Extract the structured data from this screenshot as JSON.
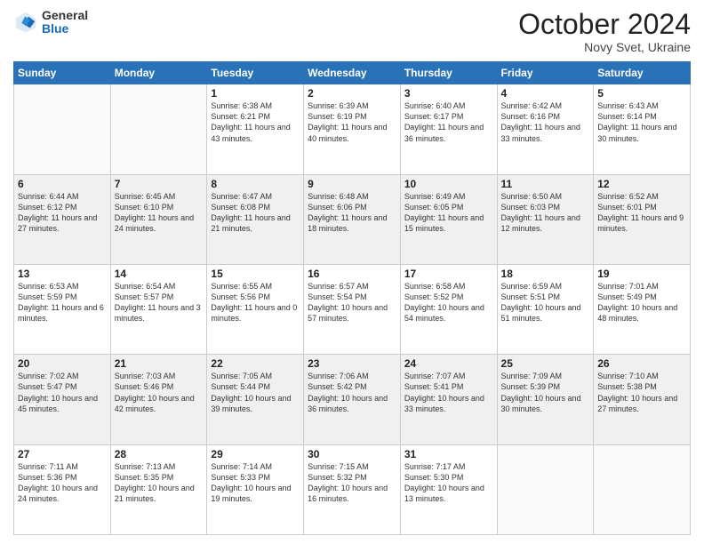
{
  "header": {
    "logo": {
      "general": "General",
      "blue": "Blue"
    },
    "month": "October 2024",
    "location": "Novy Svet, Ukraine"
  },
  "weekdays": [
    "Sunday",
    "Monday",
    "Tuesday",
    "Wednesday",
    "Thursday",
    "Friday",
    "Saturday"
  ],
  "weeks": [
    [
      {
        "day": "",
        "info": ""
      },
      {
        "day": "",
        "info": ""
      },
      {
        "day": "1",
        "info": "Sunrise: 6:38 AM\nSunset: 6:21 PM\nDaylight: 11 hours and 43 minutes."
      },
      {
        "day": "2",
        "info": "Sunrise: 6:39 AM\nSunset: 6:19 PM\nDaylight: 11 hours and 40 minutes."
      },
      {
        "day": "3",
        "info": "Sunrise: 6:40 AM\nSunset: 6:17 PM\nDaylight: 11 hours and 36 minutes."
      },
      {
        "day": "4",
        "info": "Sunrise: 6:42 AM\nSunset: 6:16 PM\nDaylight: 11 hours and 33 minutes."
      },
      {
        "day": "5",
        "info": "Sunrise: 6:43 AM\nSunset: 6:14 PM\nDaylight: 11 hours and 30 minutes."
      }
    ],
    [
      {
        "day": "6",
        "info": "Sunrise: 6:44 AM\nSunset: 6:12 PM\nDaylight: 11 hours and 27 minutes."
      },
      {
        "day": "7",
        "info": "Sunrise: 6:45 AM\nSunset: 6:10 PM\nDaylight: 11 hours and 24 minutes."
      },
      {
        "day": "8",
        "info": "Sunrise: 6:47 AM\nSunset: 6:08 PM\nDaylight: 11 hours and 21 minutes."
      },
      {
        "day": "9",
        "info": "Sunrise: 6:48 AM\nSunset: 6:06 PM\nDaylight: 11 hours and 18 minutes."
      },
      {
        "day": "10",
        "info": "Sunrise: 6:49 AM\nSunset: 6:05 PM\nDaylight: 11 hours and 15 minutes."
      },
      {
        "day": "11",
        "info": "Sunrise: 6:50 AM\nSunset: 6:03 PM\nDaylight: 11 hours and 12 minutes."
      },
      {
        "day": "12",
        "info": "Sunrise: 6:52 AM\nSunset: 6:01 PM\nDaylight: 11 hours and 9 minutes."
      }
    ],
    [
      {
        "day": "13",
        "info": "Sunrise: 6:53 AM\nSunset: 5:59 PM\nDaylight: 11 hours and 6 minutes."
      },
      {
        "day": "14",
        "info": "Sunrise: 6:54 AM\nSunset: 5:57 PM\nDaylight: 11 hours and 3 minutes."
      },
      {
        "day": "15",
        "info": "Sunrise: 6:55 AM\nSunset: 5:56 PM\nDaylight: 11 hours and 0 minutes."
      },
      {
        "day": "16",
        "info": "Sunrise: 6:57 AM\nSunset: 5:54 PM\nDaylight: 10 hours and 57 minutes."
      },
      {
        "day": "17",
        "info": "Sunrise: 6:58 AM\nSunset: 5:52 PM\nDaylight: 10 hours and 54 minutes."
      },
      {
        "day": "18",
        "info": "Sunrise: 6:59 AM\nSunset: 5:51 PM\nDaylight: 10 hours and 51 minutes."
      },
      {
        "day": "19",
        "info": "Sunrise: 7:01 AM\nSunset: 5:49 PM\nDaylight: 10 hours and 48 minutes."
      }
    ],
    [
      {
        "day": "20",
        "info": "Sunrise: 7:02 AM\nSunset: 5:47 PM\nDaylight: 10 hours and 45 minutes."
      },
      {
        "day": "21",
        "info": "Sunrise: 7:03 AM\nSunset: 5:46 PM\nDaylight: 10 hours and 42 minutes."
      },
      {
        "day": "22",
        "info": "Sunrise: 7:05 AM\nSunset: 5:44 PM\nDaylight: 10 hours and 39 minutes."
      },
      {
        "day": "23",
        "info": "Sunrise: 7:06 AM\nSunset: 5:42 PM\nDaylight: 10 hours and 36 minutes."
      },
      {
        "day": "24",
        "info": "Sunrise: 7:07 AM\nSunset: 5:41 PM\nDaylight: 10 hours and 33 minutes."
      },
      {
        "day": "25",
        "info": "Sunrise: 7:09 AM\nSunset: 5:39 PM\nDaylight: 10 hours and 30 minutes."
      },
      {
        "day": "26",
        "info": "Sunrise: 7:10 AM\nSunset: 5:38 PM\nDaylight: 10 hours and 27 minutes."
      }
    ],
    [
      {
        "day": "27",
        "info": "Sunrise: 7:11 AM\nSunset: 5:36 PM\nDaylight: 10 hours and 24 minutes."
      },
      {
        "day": "28",
        "info": "Sunrise: 7:13 AM\nSunset: 5:35 PM\nDaylight: 10 hours and 21 minutes."
      },
      {
        "day": "29",
        "info": "Sunrise: 7:14 AM\nSunset: 5:33 PM\nDaylight: 10 hours and 19 minutes."
      },
      {
        "day": "30",
        "info": "Sunrise: 7:15 AM\nSunset: 5:32 PM\nDaylight: 10 hours and 16 minutes."
      },
      {
        "day": "31",
        "info": "Sunrise: 7:17 AM\nSunset: 5:30 PM\nDaylight: 10 hours and 13 minutes."
      },
      {
        "day": "",
        "info": ""
      },
      {
        "day": "",
        "info": ""
      }
    ]
  ]
}
